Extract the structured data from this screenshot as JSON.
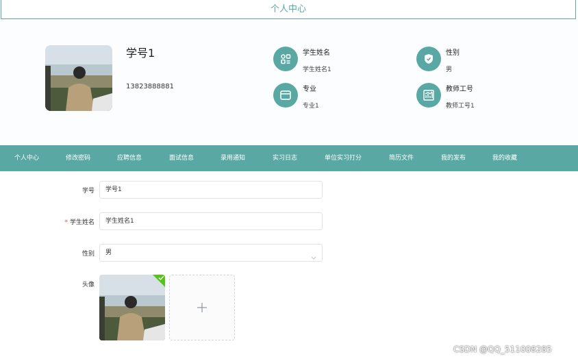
{
  "header": {
    "title": "个人中心"
  },
  "profile": {
    "name": "学号1",
    "phone": "13823888881"
  },
  "info": [
    {
      "label": "学生姓名",
      "value": "学生姓名1",
      "icon": "grid-icon"
    },
    {
      "label": "性别",
      "value": "男",
      "icon": "shield-icon"
    },
    {
      "label": "专业",
      "value": "专业1",
      "icon": "card-icon"
    },
    {
      "label": "教师工号",
      "value": "教师工号1",
      "icon": "chart-icon"
    }
  ],
  "nav": {
    "items": [
      "个人中心",
      "修改密码",
      "应聘信息",
      "面试信息",
      "录用通知",
      "实习日志",
      "单位实习打分",
      "简历文件",
      "我的发布",
      "我的收藏"
    ]
  },
  "form": {
    "student_id_label": "学号",
    "student_id_value": "学号1",
    "name_required": "*",
    "name_label": "学生姓名",
    "name_value": "学生姓名1",
    "gender_label": "性别",
    "gender_value": "男",
    "avatar_label": "头像"
  },
  "colors": {
    "accent": "#5aa8a3",
    "success": "#52c41a",
    "required": "#e24c4c"
  },
  "watermark": "CSDN @QQ_511008285"
}
